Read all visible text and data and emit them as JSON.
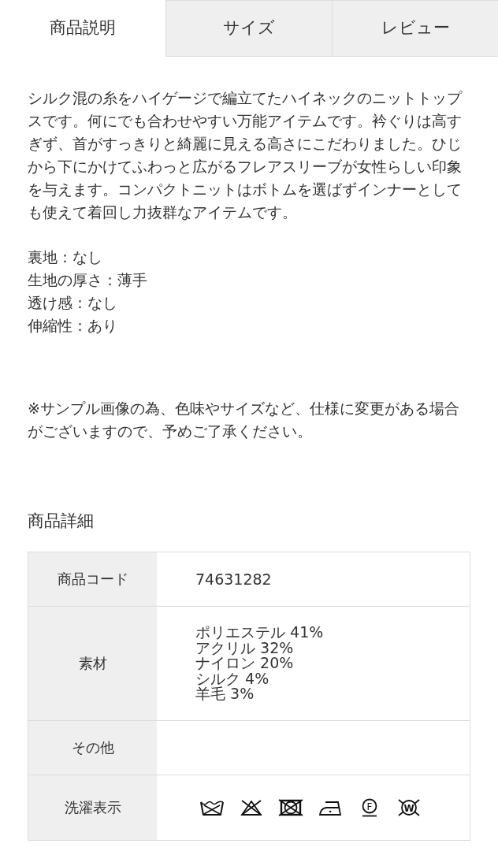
{
  "tabs": [
    {
      "label": "商品説明",
      "selected": true
    },
    {
      "label": "サイズ",
      "selected": false
    },
    {
      "label": "レビュー",
      "selected": false
    }
  ],
  "description": "シルク混の糸をハイゲージで編立てたハイネックのニットトップスです。何にでも合わせやすい万能アイテムです。衿ぐりは高すぎず、首がすっきりと綺麗に見える高さにこだわりました。ひじから下にかけてふわっと広がるフレアスリーブが女性らしい印象を与えます。コンパクトニットはボトムを選ばずインナーとしても使えて着回し力抜群なアイテムです。",
  "attributes": [
    "裏地：なし",
    "生地の厚さ：薄手",
    "透け感：なし",
    "伸縮性：あり"
  ],
  "note": "※サンプル画像の為、色味やサイズなど、仕様に変更がある場合がございますので、予めご了承ください。",
  "details": {
    "title": "商品詳細",
    "rows": [
      {
        "kind": "text",
        "label": "商品コード",
        "value": "74631282"
      },
      {
        "kind": "lines",
        "label": "素材",
        "lines": [
          "ポリエステル 41%",
          "アクリル 32%",
          "ナイロン 20%",
          "シルク 4%",
          "羊毛 3%"
        ]
      },
      {
        "kind": "empty",
        "label": "その他"
      },
      {
        "kind": "care",
        "label": "洗濯表示",
        "symbols": [
          {
            "kind": "hand_wash"
          },
          {
            "kind": "no_bleach"
          },
          {
            "kind": "no_tumble_dry"
          },
          {
            "kind": "iron_low"
          },
          {
            "kind": "dry_clean",
            "letter": "F"
          },
          {
            "kind": "no_wet_clean",
            "letter": "W"
          }
        ]
      }
    ]
  }
}
